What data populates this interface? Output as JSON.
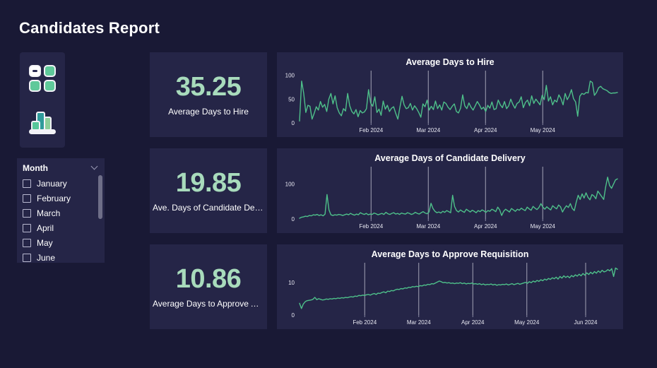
{
  "page": {
    "title": "Candidates Report",
    "background": "#191935",
    "panel_background": "#252547",
    "accent_green": "#a8dbbc",
    "line_color": "#4ec08a"
  },
  "nav": {
    "items": [
      {
        "name": "dashboard",
        "icon": "grid-icon"
      },
      {
        "name": "reports",
        "icon": "bar-chart-icon"
      }
    ]
  },
  "slicer": {
    "title": "Month",
    "chevron": "chevron-down-icon",
    "items": [
      {
        "label": "January",
        "checked": false
      },
      {
        "label": "February",
        "checked": false
      },
      {
        "label": "March",
        "checked": false
      },
      {
        "label": "April",
        "checked": false
      },
      {
        "label": "May",
        "checked": false
      },
      {
        "label": "June",
        "checked": false
      }
    ]
  },
  "kpis": [
    {
      "value": "35.25",
      "label": "Average Days to Hire"
    },
    {
      "value": "19.85",
      "label": "Ave. Days of Candidate Deliv..."
    },
    {
      "value": "10.86",
      "label": "Average Days to Approve Ac..."
    }
  ],
  "chart_data": [
    {
      "type": "line",
      "title": "Average Days to Hire",
      "xlabel": "",
      "ylabel": "",
      "ylim": [
        0,
        110
      ],
      "yticks": [
        0,
        50,
        100
      ],
      "grid": true,
      "legend": "none",
      "xticks": [
        "Feb 2024",
        "Mar 2024",
        "Apr 2024",
        "May 2024"
      ],
      "xtick_positions": [
        0.225,
        0.405,
        0.585,
        0.765
      ],
      "gridline_positions": [
        0.225,
        0.405,
        0.585,
        0.765
      ],
      "values": [
        4,
        88,
        62,
        22,
        37,
        35,
        8,
        20,
        34,
        27,
        45,
        33,
        39,
        24,
        50,
        62,
        40,
        57,
        32,
        21,
        15,
        30,
        25,
        62,
        36,
        24,
        19,
        28,
        13,
        26,
        21,
        23,
        30,
        70,
        42,
        35,
        55,
        22,
        29,
        16,
        46,
        29,
        37,
        24,
        31,
        34,
        20,
        8,
        33,
        56,
        38,
        30,
        32,
        41,
        27,
        36,
        30,
        22,
        12,
        40,
        34,
        48,
        27,
        35,
        28,
        46,
        30,
        38,
        27,
        44,
        41,
        33,
        28,
        35,
        40,
        24,
        21,
        31,
        59,
        36,
        30,
        42,
        33,
        27,
        36,
        45,
        38,
        29,
        33,
        24,
        37,
        31,
        44,
        28,
        30,
        48,
        38,
        32,
        45,
        30,
        36,
        50,
        39,
        31,
        41,
        44,
        55,
        32,
        43,
        48,
        36,
        57,
        41,
        50,
        44,
        38,
        58,
        49,
        79,
        46,
        55,
        38,
        48,
        44,
        59,
        51,
        38,
        62,
        49,
        57,
        70,
        51,
        44,
        14,
        56,
        62,
        60,
        64,
        63,
        88,
        85,
        58,
        64,
        74,
        77,
        72,
        70,
        68,
        64,
        62,
        63,
        63,
        64
      ]
    },
    {
      "type": "line",
      "title": "Average Days of Candidate Delivery",
      "xlabel": "",
      "ylabel": "",
      "ylim": [
        0,
        150
      ],
      "yticks": [
        0,
        100
      ],
      "grid": true,
      "legend": "none",
      "xticks": [
        "Feb 2024",
        "Mar 2024",
        "Apr 2024",
        "May 2024"
      ],
      "xtick_positions": [
        0.225,
        0.405,
        0.585,
        0.765
      ],
      "gridline_positions": [
        0.225,
        0.405,
        0.585,
        0.765
      ],
      "values": [
        2,
        5,
        6,
        8,
        7,
        10,
        9,
        12,
        11,
        13,
        10,
        12,
        9,
        14,
        70,
        26,
        12,
        10,
        12,
        11,
        13,
        12,
        10,
        12,
        14,
        12,
        16,
        13,
        11,
        14,
        12,
        18,
        15,
        13,
        16,
        12,
        14,
        13,
        17,
        15,
        12,
        14,
        16,
        13,
        19,
        15,
        13,
        16,
        18,
        14,
        16,
        13,
        17,
        15,
        14,
        18,
        16,
        13,
        15,
        19,
        16,
        14,
        18,
        21,
        17,
        15,
        20,
        45,
        30,
        22,
        18,
        20,
        17,
        22,
        19,
        24,
        21,
        18,
        68,
        36,
        24,
        20,
        26,
        22,
        19,
        28,
        24,
        20,
        25,
        22,
        18,
        24,
        21,
        26,
        23,
        19,
        24,
        22,
        28,
        25,
        21,
        34,
        26,
        10,
        22,
        28,
        24,
        20,
        30,
        26,
        22,
        28,
        25,
        31,
        27,
        24,
        34,
        29,
        25,
        36,
        31,
        27,
        33,
        44,
        34,
        28,
        35,
        30,
        26,
        38,
        33,
        29,
        40,
        35,
        20,
        30,
        38,
        33,
        44,
        30,
        24,
        48,
        68,
        56,
        72,
        60,
        75,
        62,
        55,
        70,
        66,
        58,
        80,
        72,
        64,
        56,
        92,
        120,
        96,
        88,
        100,
        112,
        115
      ]
    },
    {
      "type": "line",
      "title": "Average Days to Approve Requisition",
      "xlabel": "",
      "ylabel": "",
      "ylim": [
        0,
        16
      ],
      "yticks": [
        0,
        10
      ],
      "grid": true,
      "legend": "none",
      "xticks": [
        "Feb 2024",
        "Mar 2024",
        "Apr 2024",
        "May 2024",
        "Jun 2024"
      ],
      "xtick_positions": [
        0.205,
        0.375,
        0.545,
        0.715,
        0.9
      ],
      "gridline_positions": [
        0.205,
        0.375,
        0.545,
        0.715,
        0.9
      ],
      "values": [
        3.6,
        2.0,
        3.4,
        4.1,
        4.4,
        4.5,
        4.6,
        4.8,
        5.4,
        4.7,
        5.0,
        4.8,
        4.6,
        4.7,
        4.9,
        4.8,
        5.0,
        4.9,
        5.1,
        5.0,
        5.2,
        5.1,
        5.3,
        5.2,
        5.4,
        5.3,
        5.5,
        5.6,
        5.5,
        5.8,
        5.7,
        6.0,
        5.9,
        6.1,
        6.0,
        6.2,
        6.3,
        6.1,
        6.4,
        6.6,
        6.3,
        6.7,
        6.6,
        6.9,
        7.1,
        6.8,
        7.3,
        7.2,
        7.5,
        7.4,
        7.7,
        7.9,
        7.8,
        8.1,
        8.0,
        8.3,
        8.2,
        8.5,
        8.4,
        8.7,
        8.6,
        8.8,
        8.7,
        9.0,
        8.9,
        9.2,
        9.1,
        9.4,
        9.3,
        9.6,
        9.5,
        9.8,
        10.1,
        10.4,
        10.2,
        9.9,
        10.0,
        9.8,
        9.9,
        9.7,
        9.8,
        9.6,
        9.8,
        9.7,
        9.9,
        9.6,
        9.8,
        9.5,
        9.7,
        9.6,
        9.8,
        9.5,
        9.6,
        9.4,
        9.6,
        9.3,
        9.5,
        9.2,
        9.4,
        9.3,
        9.5,
        9.2,
        9.4,
        9.1,
        9.3,
        9.2,
        9.4,
        9.3,
        9.5,
        9.2,
        9.4,
        9.6,
        9.3,
        9.5,
        9.7,
        9.4,
        9.6,
        9.8,
        10.0,
        9.7,
        10.2,
        9.9,
        10.4,
        10.1,
        10.6,
        10.3,
        10.8,
        10.5,
        11.0,
        10.7,
        11.2,
        10.9,
        11.4,
        11.1,
        11.6,
        11.0,
        11.8,
        11.3,
        12.0,
        11.5,
        11.9,
        11.4,
        12.1,
        11.7,
        12.3,
        11.9,
        12.5,
        12.0,
        12.7,
        12.2,
        12.9,
        12.4,
        13.1,
        12.6,
        13.3,
        12.8,
        13.5,
        13.0,
        13.7,
        13.2,
        13.4,
        13.9,
        13.5,
        14.2,
        11.8,
        14.4,
        14.0
      ]
    }
  ]
}
